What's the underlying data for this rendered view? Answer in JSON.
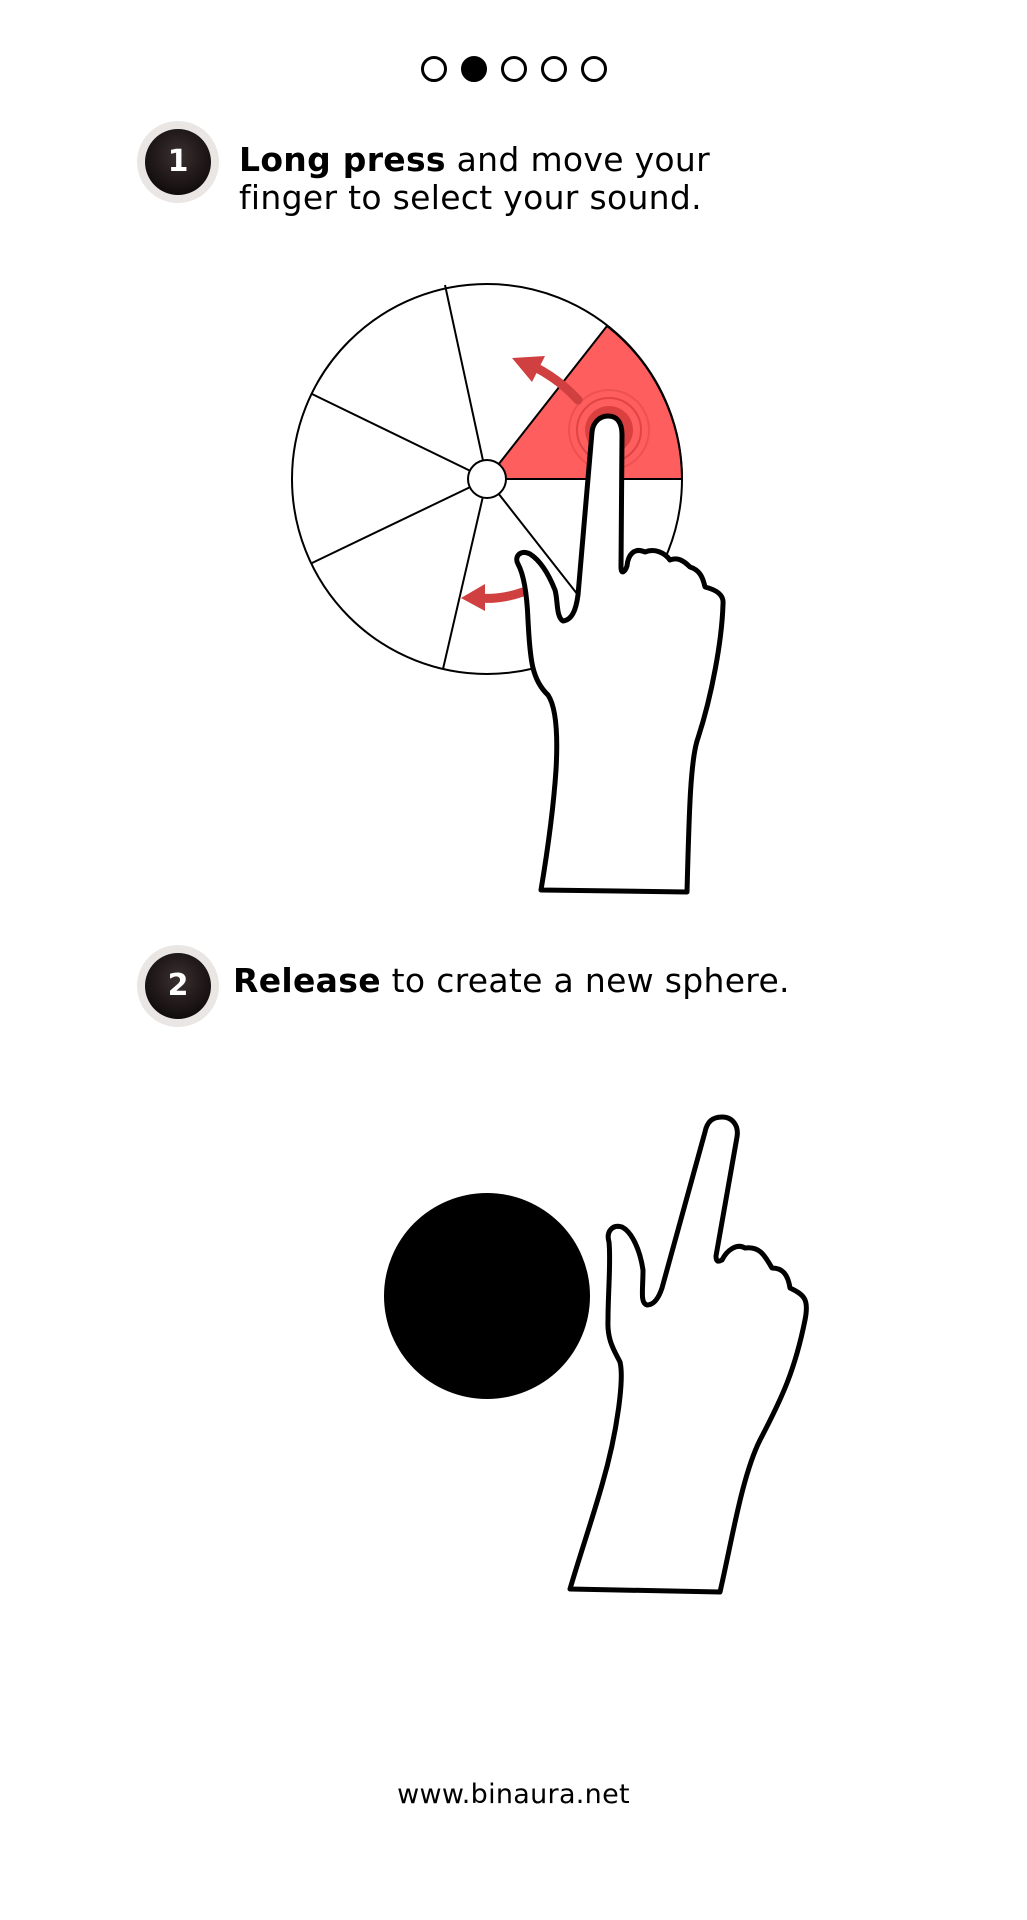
{
  "pager": {
    "count": 5,
    "active_index": 1
  },
  "steps": [
    {
      "number": "1",
      "bold": "Long press",
      "rest_line1": " and move your",
      "line2": "finger to select your sound."
    },
    {
      "number": "2",
      "bold": "Release",
      "rest_line1": " to create a new sphere."
    }
  ],
  "footer": {
    "url": "www.binaura.net"
  },
  "colors": {
    "highlight": "#ff5e5e",
    "arrow": "#d04040",
    "badge": "#1b1414",
    "badge_ring": "#e9e6e3"
  },
  "icons": {
    "wheel": "sound-selection-wheel-icon",
    "hand_press": "pressing-hand-icon",
    "hand_release": "releasing-hand-icon",
    "sphere": "sphere-icon",
    "arrow": "rotation-arrow-icon"
  }
}
